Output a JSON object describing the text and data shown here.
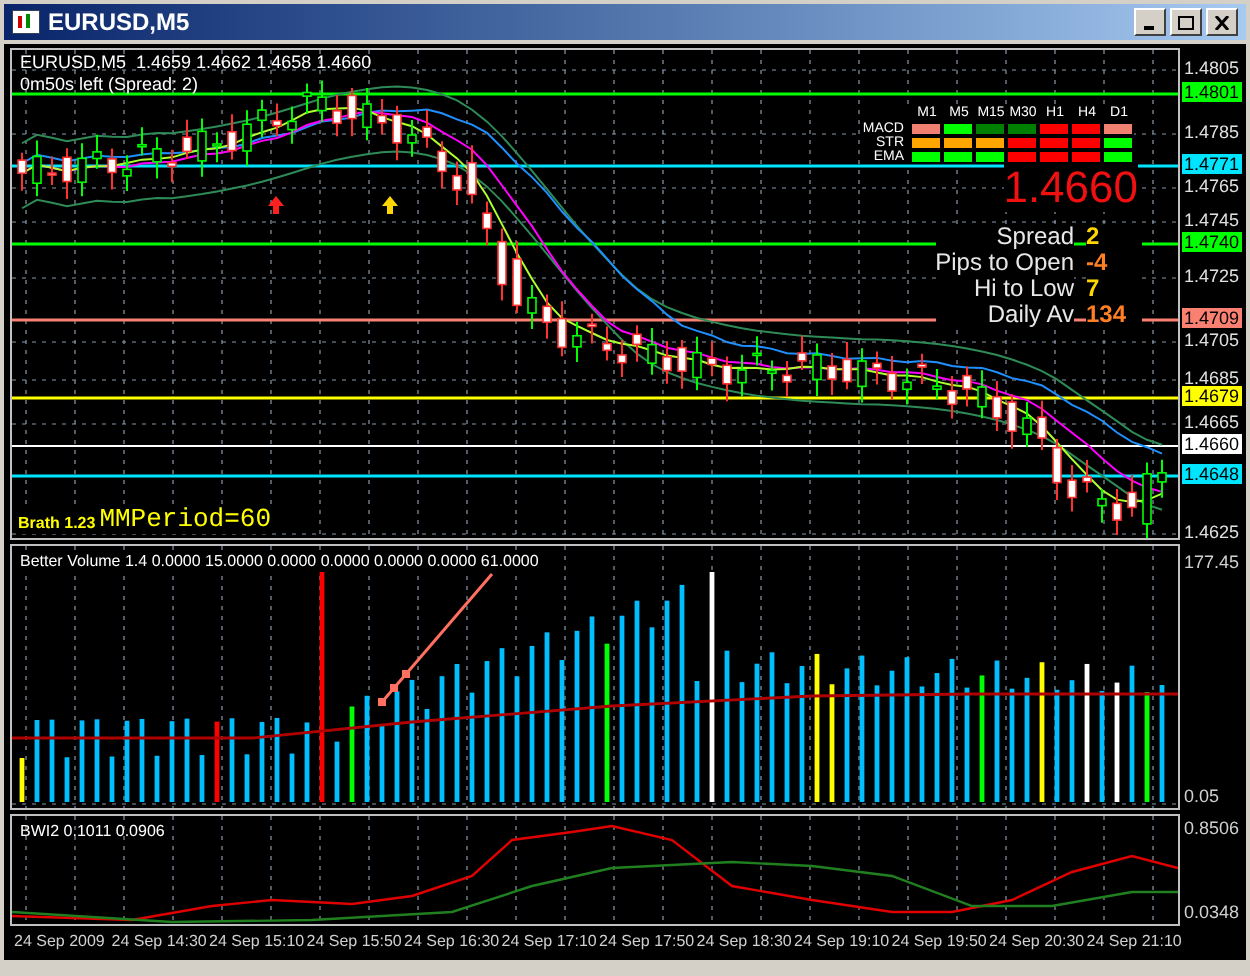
{
  "window": {
    "title": "EURUSD,M5"
  },
  "price_panel": {
    "header": "EURUSD,M5  1.4659 1.4662 1.4658 1.4660",
    "countdown": "0m50s left (Spread: 2)",
    "price_axis": [
      {
        "label": "1.4805",
        "kind": "tick"
      },
      {
        "label": "1.4801",
        "kind": "level",
        "color": "#00ff00"
      },
      {
        "label": "1.4785",
        "kind": "tick"
      },
      {
        "label": "1.4771",
        "kind": "level",
        "color": "#00e5ff"
      },
      {
        "label": "1.4765",
        "kind": "tick"
      },
      {
        "label": "1.4745",
        "kind": "tick"
      },
      {
        "label": "1.4740",
        "kind": "level",
        "color": "#00ff00"
      },
      {
        "label": "1.4725",
        "kind": "tick"
      },
      {
        "label": "1.4709",
        "kind": "level",
        "color": "#fa8072"
      },
      {
        "label": "1.4705",
        "kind": "tick"
      },
      {
        "label": "1.4685",
        "kind": "tick"
      },
      {
        "label": "1.4679",
        "kind": "level",
        "color": "#ffff00"
      },
      {
        "label": "1.4665",
        "kind": "tick"
      },
      {
        "label": "1.4660",
        "kind": "level",
        "color": "#ffffff"
      },
      {
        "label": "1.4648",
        "kind": "level",
        "color": "#00e5ff"
      },
      {
        "label": "1.4625",
        "kind": "tick"
      }
    ],
    "signal_table": {
      "columns": [
        "M1",
        "M5",
        "M15",
        "M30",
        "H1",
        "H4",
        "D1"
      ],
      "rows": [
        {
          "label": "MACD",
          "cells": [
            {
              "color": "#f08070"
            },
            {
              "color": "#00ff00"
            },
            {
              "color": "#008000"
            },
            {
              "color": "#008000"
            },
            {
              "color": "#ff0000"
            },
            {
              "color": "#ff0000"
            },
            {
              "color": "#f08070"
            }
          ]
        },
        {
          "label": "STR",
          "cells": [
            {
              "color": "#ffa500"
            },
            {
              "color": "#ffa500"
            },
            {
              "color": "#ffa500"
            },
            {
              "color": "#ff0000"
            },
            {
              "color": "#ff0000"
            },
            {
              "color": "#ff0000"
            },
            {
              "color": "#00ff00"
            }
          ]
        },
        {
          "label": "EMA",
          "cells": [
            {
              "color": "#00ff00"
            },
            {
              "color": "#00ff00"
            },
            {
              "color": "#00ff00"
            },
            {
              "color": "#ff0000"
            },
            {
              "color": "#ff0000"
            },
            {
              "color": "#ff0000"
            },
            {
              "color": "#00ff00"
            }
          ]
        }
      ]
    },
    "price": "1.4660",
    "stats": [
      {
        "label": "Spread",
        "value": "2",
        "color": "#ffd700"
      },
      {
        "label": "Pips to Open",
        "value": "-4",
        "color": "#ff7f24"
      },
      {
        "label": "Hi to Low",
        "value": "7",
        "color": "#ffd700"
      },
      {
        "label": "Daily Av",
        "value": "134",
        "color": "#ff7f24"
      }
    ],
    "brath": "Brath 1.23",
    "mm_period": "MMPeriod=60"
  },
  "volume_panel": {
    "title": "Better Volume 1.4 0.0000 15.0000 0.0000 0.0000 0.0000 0.0000 61.0000",
    "axis": [
      "177.45",
      "0.05"
    ]
  },
  "bwi_panel": {
    "title": "BWI2 0.1011 0.0906",
    "axis": [
      "0.8506",
      "0.0348"
    ]
  },
  "time_axis": [
    "24 Sep 2009",
    "24 Sep 14:30",
    "24 Sep 15:10",
    "24 Sep 15:50",
    "24 Sep 16:30",
    "24 Sep 17:10",
    "24 Sep 17:50",
    "24 Sep 18:30",
    "24 Sep 19:10",
    "24 Sep 19:50",
    "24 Sep 20:30",
    "24 Sep 21:10"
  ]
}
